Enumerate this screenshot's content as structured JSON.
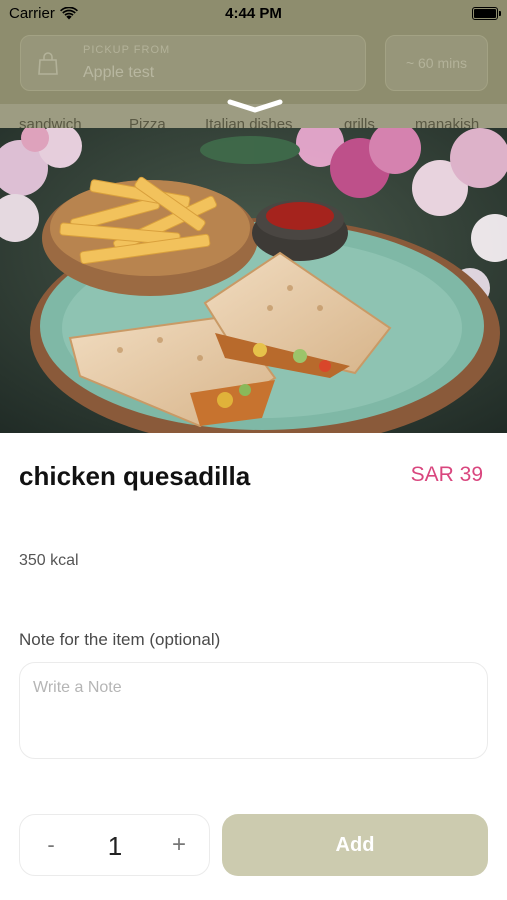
{
  "status_bar": {
    "carrier": "Carrier",
    "time": "4:44 PM"
  },
  "background_app": {
    "pickup": {
      "caption": "PICKUP FROM",
      "store": "Apple test"
    },
    "eta": "~ 60 mins",
    "categories": [
      "sandwich",
      "Pizza",
      "Italian dishes",
      "grills",
      "manakish"
    ]
  },
  "item": {
    "name": "chicken quesadilla",
    "price": "SAR 39",
    "calories": "350 kcal",
    "image_icon": "food-photo"
  },
  "note": {
    "label": "Note for the item (optional)",
    "placeholder": "Write a Note",
    "value": ""
  },
  "quantity": {
    "minus": "-",
    "value": "1",
    "plus": "+"
  },
  "add_button": {
    "label": "Add"
  },
  "colors": {
    "price": "#d9467e",
    "add_button": "#cccbaf",
    "overlay": "#8e8d6e"
  }
}
